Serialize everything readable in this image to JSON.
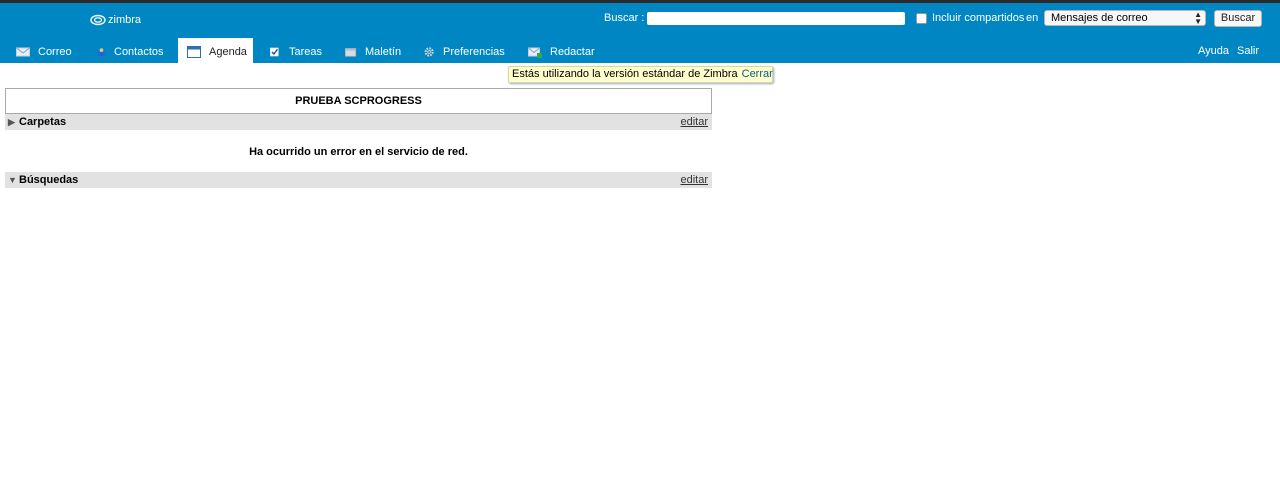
{
  "header": {
    "logo_text": "zimbra",
    "search_label": "Buscar :",
    "search_value": "",
    "shared_label": "Incluir compartidos",
    "shared_checked": false,
    "in_label": "en",
    "search_type_selected": "Mensajes de correo",
    "search_button": "Buscar",
    "help": "Ayuda",
    "logout": "Salir"
  },
  "tabs": [
    {
      "label": "Correo",
      "icon": "mail-icon",
      "active": false
    },
    {
      "label": "Contactos",
      "icon": "contact-icon",
      "active": false
    },
    {
      "label": "Agenda",
      "icon": "calendar-icon",
      "active": true
    },
    {
      "label": "Tareas",
      "icon": "tasks-icon",
      "active": false
    },
    {
      "label": "Maletín",
      "icon": "briefcase-icon",
      "active": false
    },
    {
      "label": "Preferencias",
      "icon": "gear-icon",
      "active": false
    },
    {
      "label": "Redactar",
      "icon": "compose-icon",
      "active": false
    }
  ],
  "notice": {
    "text": "Estás utilizando la versión estándar de Zimbra",
    "close": "Cerrar"
  },
  "panel": {
    "title": "PRUEBA SCPROGRESS",
    "folders_label": "Carpetas",
    "folders_edit": "editar",
    "error": "Ha ocurrido un error en el servicio de red.",
    "searches_label": "Búsquedas",
    "searches_edit": "editar"
  },
  "colors": {
    "header_bg": "#0087c3",
    "notice_bg": "#ffffcc",
    "section_bg": "#e2e2e2"
  }
}
